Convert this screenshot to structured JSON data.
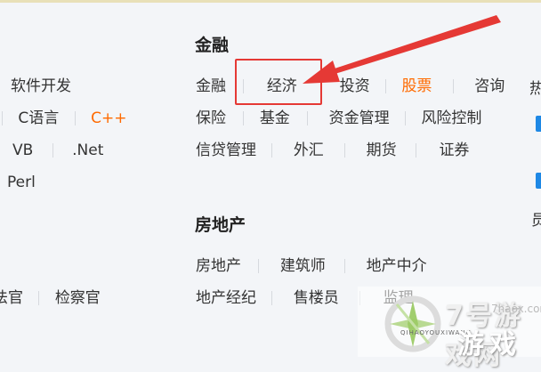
{
  "left_column": {
    "rows": [
      {
        "items": [
          {
            "label": "软件开发",
            "hot": false
          }
        ]
      },
      {
        "items": [
          {
            "label": "C语言",
            "hot": false
          },
          {
            "label": "C++",
            "hot": true
          }
        ]
      },
      {
        "items": [
          {
            "label": "VB",
            "hot": false
          },
          {
            "label": ".Net",
            "hot": false
          }
        ]
      },
      {
        "items": [
          {
            "label": "Perl",
            "hot": false
          }
        ]
      },
      {
        "items": [
          {
            "label": "法官",
            "hot": false
          },
          {
            "label": "检察官",
            "hot": false
          }
        ]
      }
    ]
  },
  "finance": {
    "heading": "金融",
    "rows": [
      {
        "items": [
          {
            "label": "金融",
            "hot": false
          },
          {
            "label": "经济",
            "hot": false
          },
          {
            "label": "投资",
            "hot": false
          },
          {
            "label": "股票",
            "hot": true
          },
          {
            "label": "咨询",
            "hot": false
          }
        ]
      },
      {
        "items": [
          {
            "label": "保险",
            "hot": false
          },
          {
            "label": "基金",
            "hot": false
          },
          {
            "label": "资金管理",
            "hot": false
          },
          {
            "label": "风险控制",
            "hot": false
          }
        ]
      },
      {
        "items": [
          {
            "label": "信贷管理",
            "hot": false
          },
          {
            "label": "外汇",
            "hot": false
          },
          {
            "label": "期货",
            "hot": false
          },
          {
            "label": "证券",
            "hot": false
          }
        ]
      }
    ]
  },
  "real_estate": {
    "heading": "房地产",
    "rows": [
      {
        "items": [
          {
            "label": "房地产",
            "hot": false
          },
          {
            "label": "建筑师",
            "hot": false
          },
          {
            "label": "地产中介",
            "hot": false
          }
        ]
      },
      {
        "items": [
          {
            "label": "地产经纪",
            "hot": false
          },
          {
            "label": "售楼员",
            "hot": false
          },
          {
            "label": "监理",
            "hot": false
          }
        ]
      }
    ]
  },
  "right_edge": {
    "char1": "热",
    "char2": "员"
  },
  "watermark": {
    "text1": "7号游戏网",
    "text2": "游戏",
    "small": "QIHAOYOUXIWANG",
    "url": "7haox.com"
  },
  "colors": {
    "hot": "#ff6a00",
    "annotation": "#e53935",
    "background": "#f3f5f8"
  }
}
